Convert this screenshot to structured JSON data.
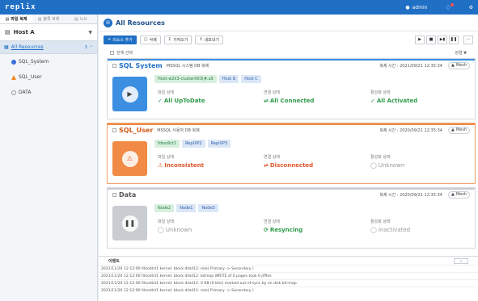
{
  "app": {
    "logo": "replix",
    "user": "admin"
  },
  "sidebar": {
    "tabs": [
      {
        "label": "파일 복제"
      },
      {
        "label": "블록 복제"
      },
      {
        "label": "노드"
      }
    ],
    "host": "Host A",
    "root": {
      "label": "All Resources",
      "count": "3"
    },
    "items": [
      {
        "label": "SQL_System",
        "status": "ok"
      },
      {
        "label": "SQL_User",
        "status": "warn"
      },
      {
        "label": "DATA",
        "status": "off"
      }
    ]
  },
  "main": {
    "title": "All Resources",
    "toolbar": {
      "add": "리소스 추가",
      "delete": "삭제",
      "import": "가져오기",
      "export": "내보내기"
    },
    "select_all": "전체 선택",
    "sort": "정렬"
  },
  "cards": [
    {
      "name": "SQL System",
      "type": "MSSQL 시스템 DB 복제",
      "date_label": "복제 시간 : 2021/09/21 12:35:34",
      "mesh": "Mesh",
      "hosts": [
        "Host-w2k3-cluster003(#.a5",
        "Host B",
        "Host C"
      ],
      "stats": [
        {
          "label": "파일 상태",
          "value": "All UpToDate"
        },
        {
          "label": "연결 상태",
          "value": "All Connected"
        },
        {
          "label": "활성화 상태",
          "value": "All Activated"
        }
      ]
    },
    {
      "name": "SQL_User",
      "type": "MSSQL 사용자 DB 복제",
      "date_label": "복제 시간 : 2020/09/21 12:35:34",
      "mesh": "Mesh",
      "hosts": [
        "fdsodlct1",
        "ReplXP2",
        "ReplXP3"
      ],
      "stats": [
        {
          "label": "파일 상태",
          "value": "Inconsistent"
        },
        {
          "label": "연결 상태",
          "value": "Disconnected"
        },
        {
          "label": "활성화 상태",
          "value": "Unknown"
        }
      ]
    },
    {
      "name": "Data",
      "type": "",
      "date_label": "복제 시간 : 2020/09/21 12:35:34",
      "mesh": "Mesh",
      "hosts": [
        "Node2",
        "Node1",
        "Node3"
      ],
      "stats": [
        {
          "label": "파일 상태",
          "value": "Unknown"
        },
        {
          "label": "연결 상태",
          "value": "Resyncing"
        },
        {
          "label": "활성화 상태",
          "value": "Inactivated"
        }
      ]
    }
  ],
  "events": {
    "title": "이벤트",
    "rows": [
      "2021/11/20   12:12:00   fdsodlct1 kernel: block drbd12: role( Primary -> Secondary )",
      "2021/11/20   12:12:00   fdsodlct1 kernel: block drbd12: bitmap WRITE of 0 pages took 0 jiffies",
      "2021/11/20   12:12:00   fdsodlct1 kernel: block drbd12: 0 KB (0 bits) marked out-of-sync by on disk bit-map.",
      "2021/11/20   12:12:00   fdsodlct1 kernel: block drbd11: role( Primary -> Secondary )"
    ]
  },
  "colors": {
    "accent": "#1f6fc5",
    "warn": "#f08a44",
    "ok": "#2e9a4a"
  }
}
